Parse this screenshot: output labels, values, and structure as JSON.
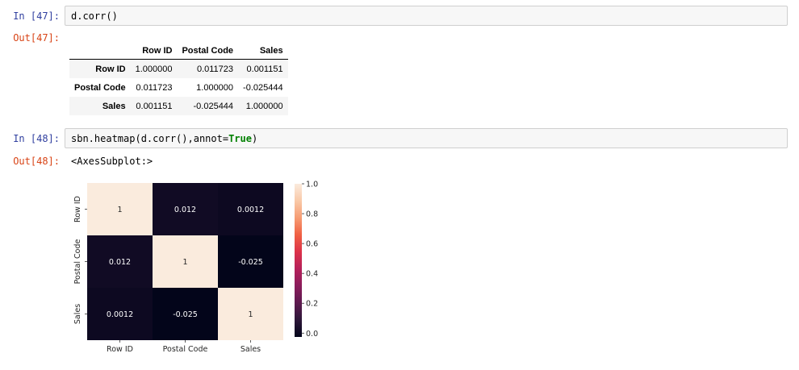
{
  "cells": [
    {
      "in_prompt": "In [47]:",
      "code": "d.corr()",
      "out_prompt": "Out[47]:"
    },
    {
      "in_prompt": "In [48]:",
      "code_before": "sbn.heatmap(d.corr(),annot=",
      "code_kw": "True",
      "code_after": ")",
      "out_prompt": "Out[48]:",
      "out_text": "<AxesSubplot:>"
    }
  ],
  "dataframe": {
    "columns": [
      "Row ID",
      "Postal Code",
      "Sales"
    ],
    "rows": [
      {
        "index": "Row ID",
        "values": [
          "1.000000",
          "0.011723",
          "0.001151"
        ]
      },
      {
        "index": "Postal Code",
        "values": [
          "0.011723",
          "1.000000",
          "-0.025444"
        ]
      },
      {
        "index": "Sales",
        "values": [
          "0.001151",
          "-0.025444",
          "1.000000"
        ]
      }
    ]
  },
  "chart_data": {
    "type": "heatmap",
    "x_categories": [
      "Row ID",
      "Postal Code",
      "Sales"
    ],
    "y_categories": [
      "Row ID",
      "Postal Code",
      "Sales"
    ],
    "values": [
      [
        1.0,
        0.011723,
        0.001151
      ],
      [
        0.011723,
        1.0,
        -0.025444
      ],
      [
        0.001151,
        -0.025444,
        1.0
      ]
    ],
    "annotations": [
      [
        "1",
        "0.012",
        "0.0012"
      ],
      [
        "0.012",
        "1",
        "-0.025"
      ],
      [
        "0.0012",
        "-0.025",
        "1"
      ]
    ],
    "colorbar": {
      "min": -0.025444,
      "max": 1.0,
      "ticks": [
        0.0,
        0.2,
        0.4,
        0.6,
        0.8,
        1.0
      ],
      "tick_labels": [
        "0.0",
        "0.2",
        "0.4",
        "0.6",
        "0.8",
        "1.0"
      ]
    },
    "colormap": "rocket",
    "colormap_stops": [
      "#03051a",
      "#2d1739",
      "#5d1a4f",
      "#8a1c5b",
      "#b5205a",
      "#dc3249",
      "#f06043",
      "#f69c73",
      "#f9c9a8",
      "#faebdd"
    ]
  }
}
